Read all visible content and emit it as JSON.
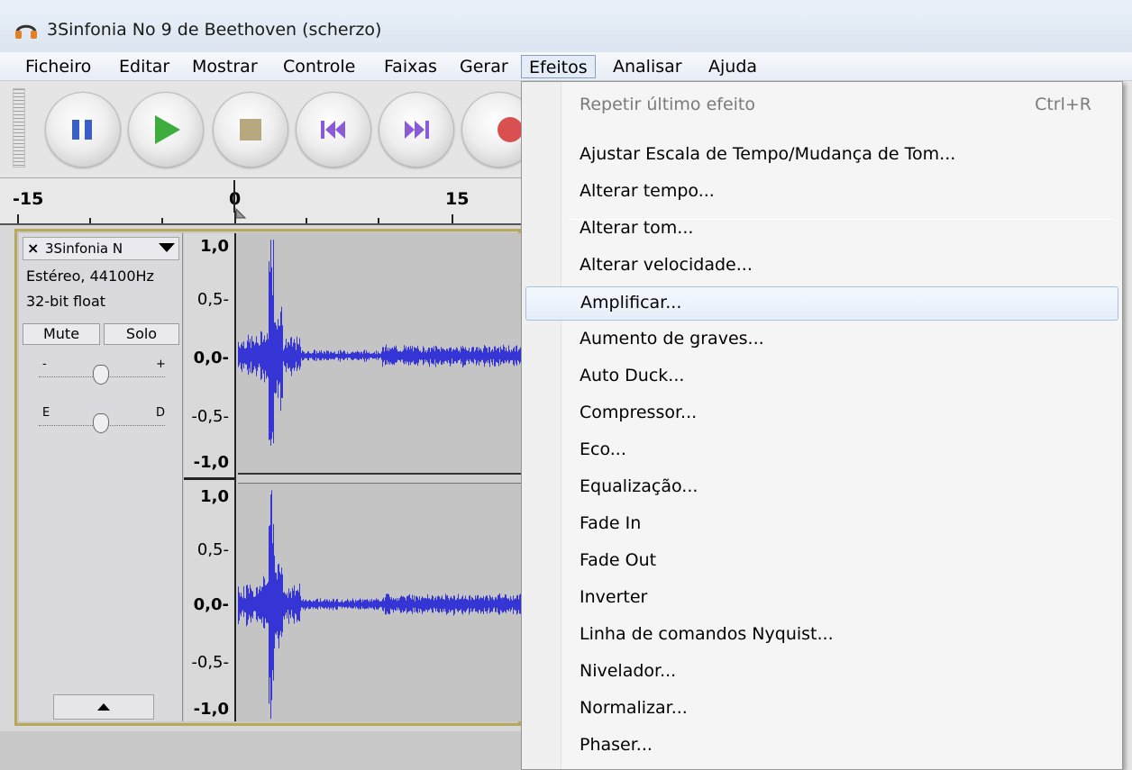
{
  "window": {
    "title": "3Sinfonia No 9 de Beethoven (scherzo)",
    "icon": "headphones-icon"
  },
  "menubar": {
    "items": [
      "Ficheiro",
      "Editar",
      "Mostrar",
      "Controle",
      "Faixas",
      "Gerar",
      "Efeitos",
      "Analisar",
      "Ajuda"
    ],
    "active": "Efeitos"
  },
  "toolbar": {
    "buttons": [
      "pause-icon",
      "play-icon",
      "stop-icon",
      "skip-start-icon",
      "skip-end-icon",
      "record-icon"
    ]
  },
  "ruler": {
    "labels": [
      "-15",
      "0",
      "15"
    ]
  },
  "track": {
    "name": "3Sinfonia N",
    "close_label": "×",
    "format": "Estéreo, 44100Hz",
    "bit_depth": "32-bit float",
    "mute_label": "Mute",
    "solo_label": "Solo",
    "gain_minus": "-",
    "gain_plus": "+",
    "pan_left": "E",
    "pan_right": "D"
  },
  "scale": {
    "channel1": [
      "1,0",
      "0,5-",
      "0,0-",
      "-0,5-",
      "-1,0"
    ],
    "channel2": [
      "1,0",
      "0,5-",
      "0,0-",
      "-0,5-",
      "-1,0"
    ]
  },
  "waveform_color": "#3535d6",
  "effects_menu": {
    "items": [
      {
        "label": "Repetir último efeito",
        "shortcut": "Ctrl+R",
        "disabled": true
      },
      {
        "label": "Ajustar Escala de Tempo/Mudança de Tom..."
      },
      {
        "label": "Alterar tempo..."
      },
      {
        "label": "Alterar tom..."
      },
      {
        "label": "Alterar velocidade..."
      },
      {
        "label": "Amplificar...",
        "highlighted": true
      },
      {
        "label": "Aumento de graves..."
      },
      {
        "label": "Auto Duck..."
      },
      {
        "label": "Compressor..."
      },
      {
        "label": "Eco..."
      },
      {
        "label": "Equalização..."
      },
      {
        "label": "Fade In"
      },
      {
        "label": "Fade Out"
      },
      {
        "label": "Inverter"
      },
      {
        "label": "Linha de comandos Nyquist..."
      },
      {
        "label": "Nivelador..."
      },
      {
        "label": "Normalizar..."
      },
      {
        "label": "Phaser..."
      }
    ]
  }
}
